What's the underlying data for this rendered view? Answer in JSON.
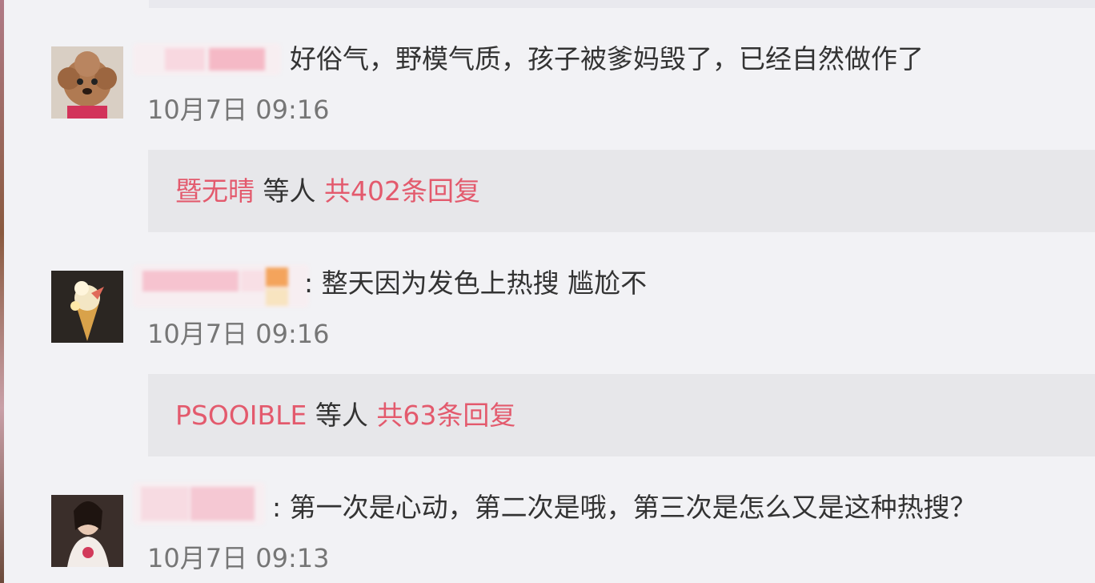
{
  "comments": [
    {
      "text": "好俗气，野模气质，孩子被爹妈毁了，已经自然做作了",
      "time": "10月7日 09:16",
      "avatar_icon": "poodle-dog-avatar",
      "replies": {
        "user": "暨无晴",
        "middle": "等人",
        "count_text": "共402条回复"
      }
    },
    {
      "text": ": 整天因为发色上热搜 尴尬不",
      "time": "10月7日 09:16",
      "avatar_icon": "ice-cream-cone-avatar",
      "replies": {
        "user": "PSOOIBLE",
        "middle": "等人",
        "count_text": "共63条回复"
      }
    },
    {
      "text": ": 第一次是心动，第二次是哦，第三次是怎么又是这种热搜？",
      "time": "10月7日 09:13",
      "avatar_icon": "woman-portrait-avatar"
    }
  ],
  "colors": {
    "background": "#f2f2f5",
    "reply_box": "#e7e7ea",
    "link_pink": "#e35a6d",
    "time_gray": "#767676",
    "text": "#333333"
  }
}
